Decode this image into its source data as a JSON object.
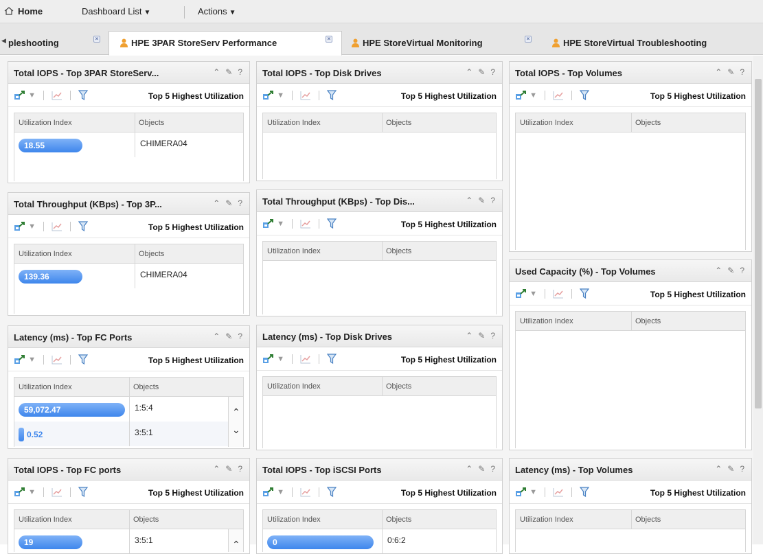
{
  "menubar": {
    "home": "Home",
    "dashboard_list": "Dashboard List",
    "actions": "Actions"
  },
  "tabs": [
    {
      "label": "pleshooting"
    },
    {
      "label": "HPE 3PAR StoreServ Performance"
    },
    {
      "label": "HPE StoreVirtual Monitoring"
    },
    {
      "label": "HPE StoreVirtual Troubleshooting"
    }
  ],
  "common": {
    "toolbar_label": "Top 5 Highest Utilization",
    "col_util": "Utilization Index",
    "col_obj": "Objects",
    "ctrl_collapse": "⌃",
    "ctrl_edit": "✎",
    "ctrl_help": "?"
  },
  "icons": {
    "home": "home-icon",
    "user": "user-icon",
    "export": "export-icon",
    "chart": "chart-icon",
    "filter": "filter-icon",
    "close": "close-icon"
  },
  "colors": {
    "bar_top": "#7fb2f7",
    "bar_bottom": "#3e86ec",
    "accent_orange": "#f0a030"
  },
  "panels": [
    {
      "title": "Total IOPS - Top 3PAR StoreServ...",
      "rows": [
        {
          "value": "18.55",
          "fraction": 0.55,
          "object": "CHIMERA04"
        }
      ]
    },
    {
      "title": "Total Throughput (KBps) - Top 3P...",
      "rows": [
        {
          "value": "139.36",
          "fraction": 0.55,
          "object": "CHIMERA04"
        }
      ]
    },
    {
      "title": "Latency (ms) - Top FC Ports",
      "rows": [
        {
          "value": "59,072.47",
          "fraction": 1.0,
          "object": "1:5:4"
        },
        {
          "value": "0.52",
          "fraction": 0.0,
          "object": "3:5:1"
        }
      ]
    },
    {
      "title": "Total IOPS - Top FC ports",
      "rows": [
        {
          "value": "19",
          "fraction": 0.6,
          "object": "3:5:1"
        }
      ]
    },
    {
      "title": "Total IOPS - Top Disk Drives",
      "rows": []
    },
    {
      "title": "Total Throughput (KBps) - Top Dis...",
      "rows": []
    },
    {
      "title": "Latency (ms) - Top Disk Drives",
      "rows": []
    },
    {
      "title": "Total IOPS - Top iSCSI Ports",
      "rows": [
        {
          "value": "0",
          "fraction": 0.0,
          "object": "0:6:2"
        }
      ]
    },
    {
      "title": "Total IOPS - Top Volumes",
      "rows": []
    },
    {
      "title": "Used Capacity (%) - Top Volumes",
      "rows": []
    },
    {
      "title": "Latency (ms) - Top Volumes",
      "rows": []
    }
  ]
}
